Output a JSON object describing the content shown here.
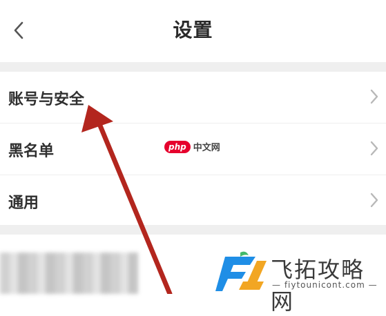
{
  "header": {
    "title": "设置",
    "back_icon": "chevron-left-icon"
  },
  "settings": {
    "items": [
      {
        "label": "账号与安全",
        "icon": "chevron-right-icon"
      },
      {
        "label": "黑名单",
        "icon": "chevron-right-icon"
      },
      {
        "label": "通用",
        "icon": "chevron-right-icon"
      }
    ]
  },
  "watermark": {
    "php_badge": "php",
    "php_text": "中文网",
    "brand_name": "飞拓攻略网",
    "brand_url": "— fiytounicont.com —"
  },
  "annotation": {
    "arrow_color": "#b3261e"
  },
  "colors": {
    "background": "#ffffff",
    "separator": "#efefef",
    "text": "#2f2f2f",
    "chevron": "#b8b8b8"
  }
}
